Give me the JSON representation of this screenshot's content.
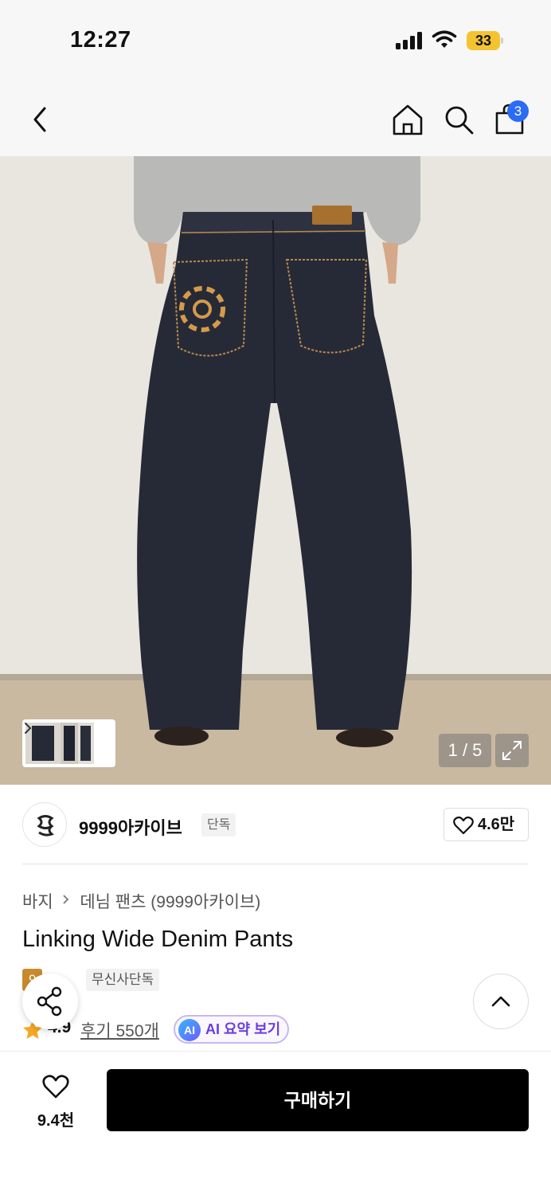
{
  "status_bar": {
    "time": "12:27",
    "battery": "33",
    "icons": [
      "signal-icon",
      "wifi-icon",
      "battery-icon"
    ]
  },
  "nav": {
    "cart_count": "3",
    "icons": [
      "back-icon",
      "home-icon",
      "search-icon",
      "cart-icon"
    ]
  },
  "gallery": {
    "pager": "1 / 5"
  },
  "brand": {
    "name": "9999아카이브",
    "badge": "단독",
    "likes": "4.6만"
  },
  "breadcrumb": {
    "category": "바지",
    "subcategory": "데님 팬츠 (9999아카이브)"
  },
  "product": {
    "title": "Linking Wide Denim Pants",
    "tag_discount": "9",
    "tag_exclusive": "무신사단독",
    "rating": "4.9",
    "reviews": "후기 550개",
    "ai_summary": "AI 요약 보기",
    "ai_badge": "AI"
  },
  "bottom_bar": {
    "wish_count": "9.4천",
    "buy_label": "구매하기"
  },
  "colors": {
    "accent_blue": "#2a6cf6",
    "discount_tag": "#c98a2c",
    "ai_purple": "#6a3ee0",
    "star": "#f5a623",
    "buy_button": "#000000"
  }
}
